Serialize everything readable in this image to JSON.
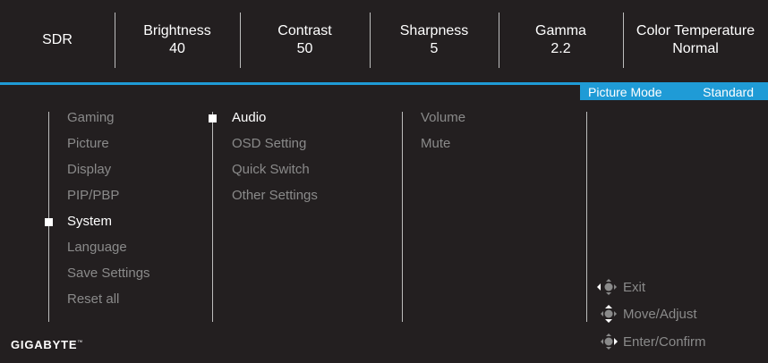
{
  "status": [
    {
      "name": "SDR",
      "value": ""
    },
    {
      "name": "Brightness",
      "value": "40"
    },
    {
      "name": "Contrast",
      "value": "50"
    },
    {
      "name": "Sharpness",
      "value": "5"
    },
    {
      "name": "Gamma",
      "value": "2.2"
    },
    {
      "name": "Color Temperature",
      "value": "Normal"
    }
  ],
  "mode": {
    "label": "Picture Mode",
    "value": "Standard"
  },
  "main_menu": [
    "Gaming",
    "Picture",
    "Display",
    "PIP/PBP",
    "System",
    "Language",
    "Save Settings",
    "Reset all"
  ],
  "system_submenu": [
    "Audio",
    "OSD Setting",
    "Quick Switch",
    "Other Settings"
  ],
  "audio_submenu": [
    "Volume",
    "Mute"
  ],
  "hints": {
    "exit": "Exit",
    "move": "Move/Adjust",
    "enter": "Enter/Confirm"
  },
  "brand": "GIGABYTE",
  "colors": {
    "accent": "#1f9bd6",
    "background": "#231f20",
    "inactive_text": "#8a8a8a"
  }
}
